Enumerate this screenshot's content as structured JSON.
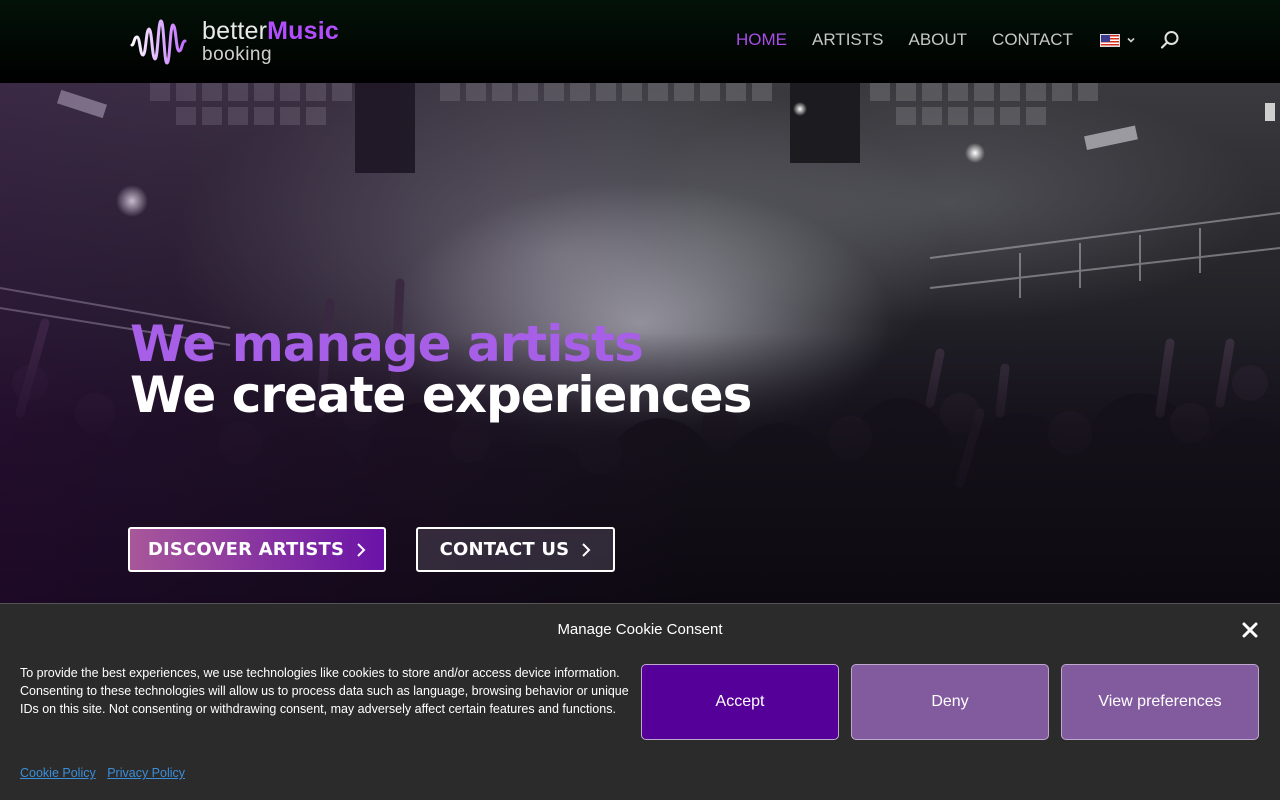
{
  "brand": {
    "name_part1": "better",
    "name_part2": "Music",
    "subtitle": "booking",
    "logo_icon": "sound-wave-logo-icon",
    "accent_color": "#b34dff"
  },
  "nav": {
    "items": [
      {
        "label": "HOME",
        "active": true
      },
      {
        "label": "ARTISTS",
        "active": false
      },
      {
        "label": "ABOUT",
        "active": false
      },
      {
        "label": "CONTACT",
        "active": false
      }
    ],
    "language_icon": "us-flag-icon",
    "search_icon": "search-icon"
  },
  "hero": {
    "headline_line1": "We manage artists",
    "headline_line2": "We create experiences",
    "buttons": {
      "discover": "DISCOVER ARTISTS",
      "contact": "CONTACT US"
    }
  },
  "cookie": {
    "title": "Manage Cookie Consent",
    "text": "To provide the best experiences, we use technologies like cookies to store and/or access device information. Consenting to these technologies will allow us to process data such as language, browsing behavior or unique IDs on this site. Not consenting or withdrawing consent, may adversely affect certain features and functions.",
    "accept_label": "Accept",
    "deny_label": "Deny",
    "preferences_label": "View preferences",
    "links": {
      "cookie_policy": "Cookie Policy",
      "privacy_policy": "Privacy Policy"
    },
    "colors": {
      "accept": "#56009a",
      "secondary": "#825b9e",
      "link": "#3b8ed8"
    }
  }
}
